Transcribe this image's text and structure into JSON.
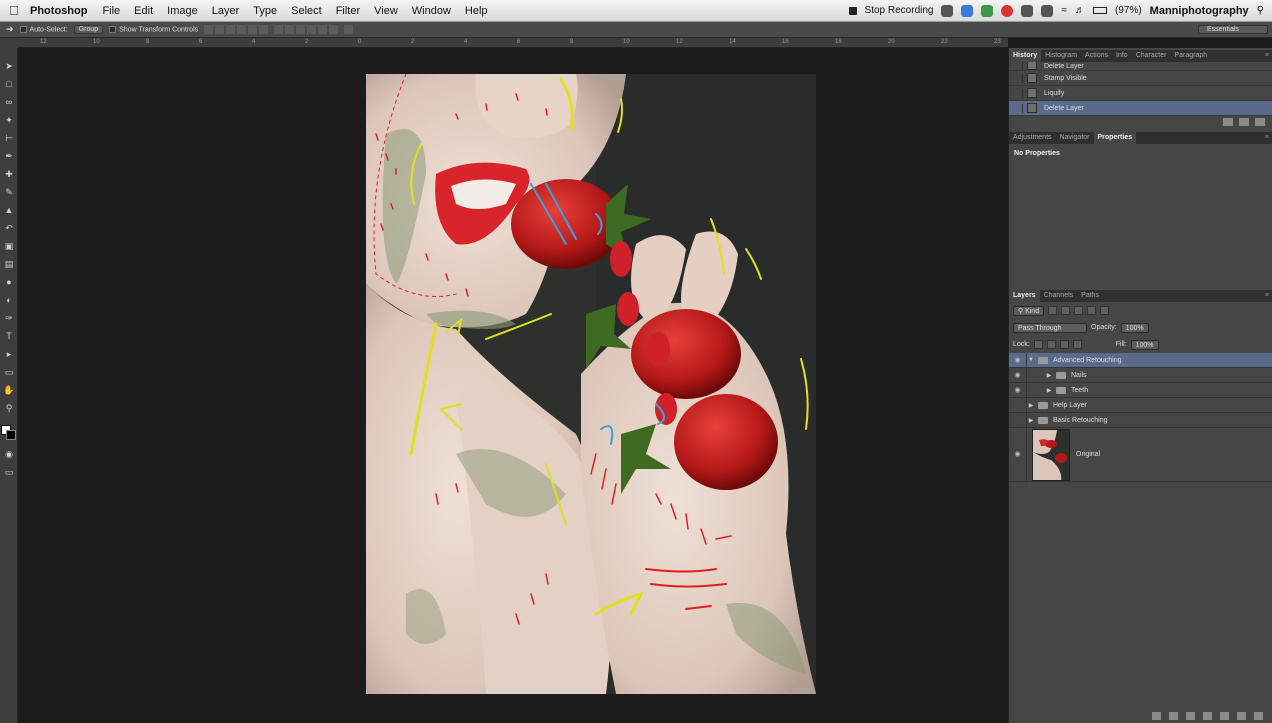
{
  "menubar": {
    "app": "Photoshop",
    "menus": [
      "File",
      "Edit",
      "Image",
      "Layer",
      "Type",
      "Select",
      "Filter",
      "View",
      "Window",
      "Help"
    ],
    "stop_recording": "Stop Recording",
    "battery": "(97%)",
    "user": "Manniphotography"
  },
  "options": {
    "auto_select": "Auto-Select:",
    "group": "Group",
    "show_transform": "Show Transform Controls",
    "workspace": "Essentials"
  },
  "ruler": [
    "12",
    "10",
    "8",
    "6",
    "4",
    "2",
    "0",
    "2",
    "4",
    "6",
    "8",
    "10",
    "12",
    "14",
    "16",
    "18",
    "20",
    "22",
    "23"
  ],
  "history": {
    "tabs": [
      "History",
      "Histogram",
      "Actions",
      "Info",
      "Character",
      "Paragraph"
    ],
    "items": [
      "Delete Layer",
      "Stamp Visible",
      "Liquify",
      "Delete Layer"
    ]
  },
  "properties": {
    "tabs": [
      "Adjustments",
      "Navigator",
      "Properties"
    ],
    "message": "No Properties"
  },
  "layers": {
    "tabs": [
      "Layers",
      "Channels",
      "Paths"
    ],
    "kind": "Kind",
    "blend_mode": "Pass Through",
    "opacity_label": "Opacity:",
    "opacity": "100%",
    "lock_label": "Lock:",
    "fill_label": "Fill:",
    "fill": "100%",
    "items": [
      {
        "name": "Advanced Retouching"
      },
      {
        "name": "Nails"
      },
      {
        "name": "Teeth"
      },
      {
        "name": "Help Layer"
      },
      {
        "name": "Basic Retouching"
      },
      {
        "name": "Original"
      }
    ]
  },
  "colors": {
    "accent": "#5a6a8a",
    "panel": "#464646",
    "canvas": "#1c1c1c"
  }
}
